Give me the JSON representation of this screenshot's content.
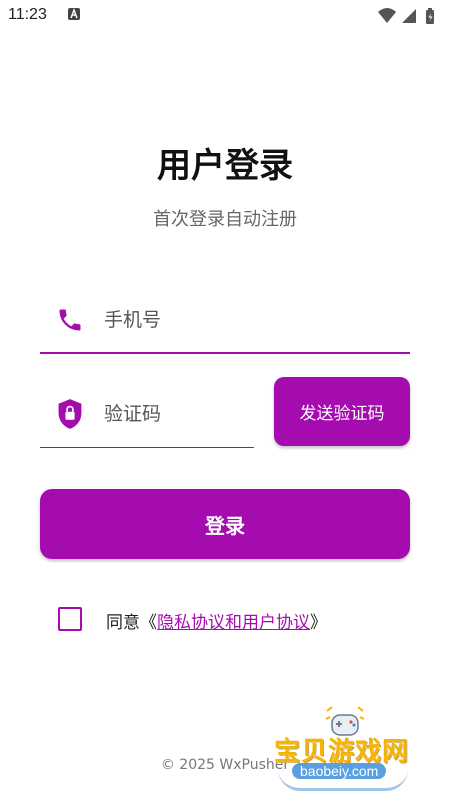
{
  "status_bar": {
    "time": "11:23"
  },
  "header": {
    "title": "用户登录",
    "subtitle": "首次登录自动注册"
  },
  "form": {
    "phone_placeholder": "手机号",
    "phone_value": "",
    "code_placeholder": "验证码",
    "code_value": "",
    "send_code_label": "发送验证码",
    "login_label": "登录"
  },
  "agreement": {
    "checked": false,
    "prefix": "同意《",
    "link_text": "隐私协议和用户协议",
    "suffix": "》"
  },
  "footer": {
    "copyright": "© 2025 WxPusher"
  },
  "watermark": {
    "text": "宝贝游戏网",
    "url": "baobeiy.com"
  },
  "colors": {
    "accent": "#a50cb0",
    "text": "#111111",
    "muted": "#666666"
  },
  "icons": {
    "phone": "phone-icon",
    "code": "shield-lock-icon",
    "status_a": "a-icon",
    "wifi": "wifi-icon",
    "signal": "signal-icon",
    "battery": "battery-icon"
  }
}
